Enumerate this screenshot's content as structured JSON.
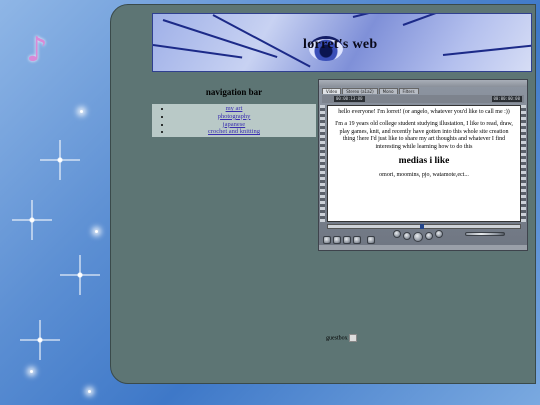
{
  "header": {
    "site_title": "lorret's web"
  },
  "navigation": {
    "title": "navigation bar",
    "items": [
      {
        "label": "my art"
      },
      {
        "label": "photography"
      },
      {
        "label": "japanese"
      },
      {
        "label": "crochet and knitting"
      }
    ]
  },
  "player": {
    "tabs": [
      "Video",
      "Stereo (a1a2)",
      "Mono",
      "Filters"
    ],
    "timecode_left": "00:00:13:00",
    "timecode_right": "00:00:00:00",
    "content": {
      "greeting": "hello everyone! I'm lorret! (or angelo, whatever you'd like to call me :))",
      "about": "I'm a 19 years old college student studying illustation, I like to read, draw, play games, knit, and recently have gotten into this whole site creation thing !here I'd just like to share my art thoughts and whatever I find interesting while learning how to do this",
      "media_heading": "medias i like",
      "media_list": "omori, moomins, pjo, watamote,ect..."
    }
  },
  "guestbook": {
    "label": "guestbox"
  },
  "colors": {
    "panel": "#5d7574",
    "nav_box": "#b9c9c7",
    "link": "#3a2fb0",
    "background": "#5c8fd3"
  }
}
